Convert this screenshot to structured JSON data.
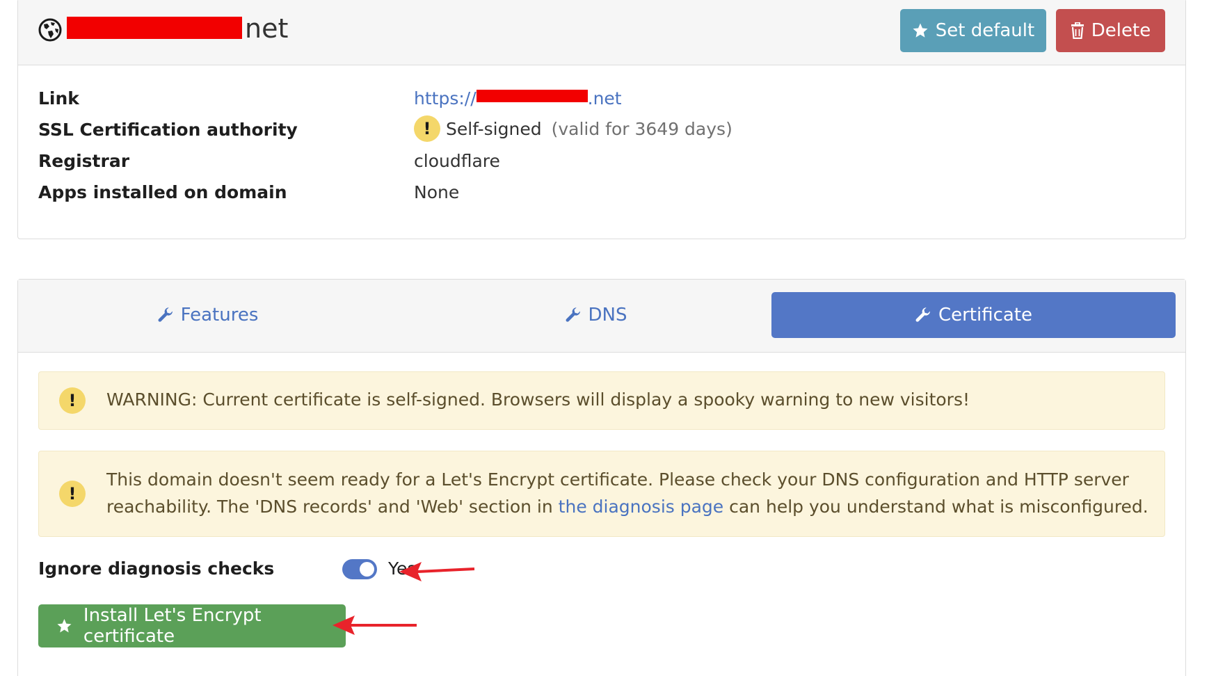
{
  "header": {
    "domain_suffix": "net",
    "set_default_label": "Set default",
    "delete_label": "Delete"
  },
  "info": {
    "rows": [
      {
        "label": "Link",
        "value_prefix": "https://",
        "value_suffix": ".net"
      },
      {
        "label": "SSL Certification authority",
        "value": "Self-signed",
        "note": "(valid for 3649 days)"
      },
      {
        "label": "Registrar",
        "value": "cloudflare"
      },
      {
        "label": "Apps installed on domain",
        "value": "None"
      }
    ]
  },
  "tabs": [
    {
      "label": "Features",
      "active": false
    },
    {
      "label": "DNS",
      "active": false
    },
    {
      "label": "Certificate",
      "active": true
    }
  ],
  "alerts": {
    "self_signed": "WARNING: Current certificate is self-signed. Browsers will display a spooky warning to new visitors!",
    "not_ready": {
      "text_before": "This domain doesn't seem ready for a Let's Encrypt certificate. Please check your DNS configuration and HTTP server reachability. The 'DNS records' and 'Web' section in ",
      "link": "the diagnosis page",
      "text_after": " can help you understand what is misconfigured."
    }
  },
  "ignore_checks": {
    "label": "Ignore diagnosis checks",
    "value": "Yes",
    "enabled": true
  },
  "install_button_label": "Install Let's Encrypt certificate",
  "colors": {
    "primary": "#5377c6",
    "info_button": "#5a9fb7",
    "danger_button": "#c34f4f",
    "success_button": "#5ba058",
    "warning_bg": "#fcf5dd",
    "warning_icon": "#f4d76a",
    "redaction": "#f20000",
    "annotation_arrow": "#e8232b"
  },
  "icons": {
    "title": "globe-icon",
    "set_default": "star-icon",
    "delete": "trash-icon",
    "tabs": "wrench-icon",
    "warning": "exclamation-icon",
    "install": "star-icon"
  }
}
